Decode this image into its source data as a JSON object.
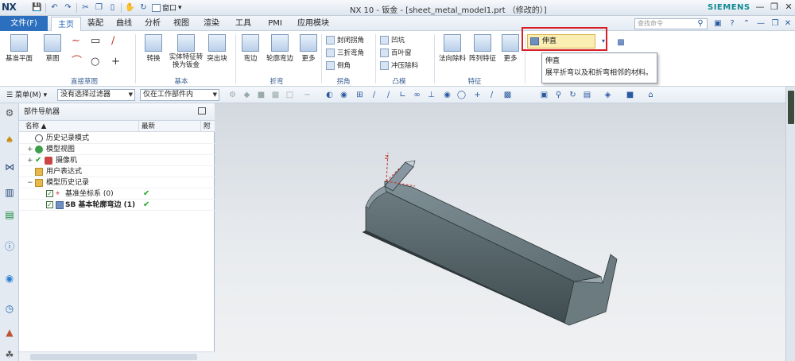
{
  "app": {
    "logo": "NX",
    "title": "NX 10 - 钣金 - [sheet_metal_model1.prt （修改的）]",
    "brand": "SIEMENS",
    "window_menu": "窗口"
  },
  "tabs": {
    "file": "文件(F)",
    "items": [
      "主页",
      "装配",
      "曲线",
      "分析",
      "视图",
      "渲染",
      "工具",
      "PMI",
      "应用模块"
    ],
    "active_index": 0
  },
  "search": {
    "placeholder": "查找命令"
  },
  "ribbon": {
    "groups": {
      "sketch": "直接草图",
      "basic": "基本",
      "bend": "折弯",
      "corner": "拐角",
      "punch": "凸模",
      "feature": "特征"
    },
    "buttons": {
      "datum_plane": "基准平面",
      "sketch": "草图",
      "convert": "转换",
      "solid_to_sheet": "实体特征转换为钣金",
      "tab": "突出块",
      "flange": "弯边",
      "contour_flange": "轮廓弯边",
      "more_bend": "更多",
      "closed_corner": "封闭拐角",
      "three_bend_corner": "三折弯角",
      "chamfer": "倒角",
      "dimple": "凹坑",
      "louver": "百叶窗",
      "punch_removal": "冲压除料",
      "normal_cutout": "法向除料",
      "pattern_feature": "阵列特征",
      "more_feature": "更多",
      "unbend": "伸直"
    }
  },
  "tooltip": {
    "title": "伸直",
    "description": "展平折弯以及和折弯相邻的材料。"
  },
  "selection_bar": {
    "menu": "菜单(M)",
    "filter": "没有选择过滤器",
    "scope": "仅在工作部件内"
  },
  "navigator": {
    "title": "部件导航器",
    "columns": {
      "name": "名称",
      "latest": "最新",
      "third": "附"
    },
    "nodes": [
      {
        "label": "历史记录模式"
      },
      {
        "label": "模型视图"
      },
      {
        "label": "摄像机"
      },
      {
        "label": "用户表达式"
      },
      {
        "label": "模型历史记录"
      },
      {
        "label": "基准坐标系 (0)"
      },
      {
        "label": "SB 基本轮廓弯边 (1)"
      }
    ]
  },
  "colors": {
    "file_tab": "#2c6fbe",
    "highlight_frame": "#d91e26",
    "model_fill": "#5c6b70",
    "checkmark": "#22a329"
  }
}
